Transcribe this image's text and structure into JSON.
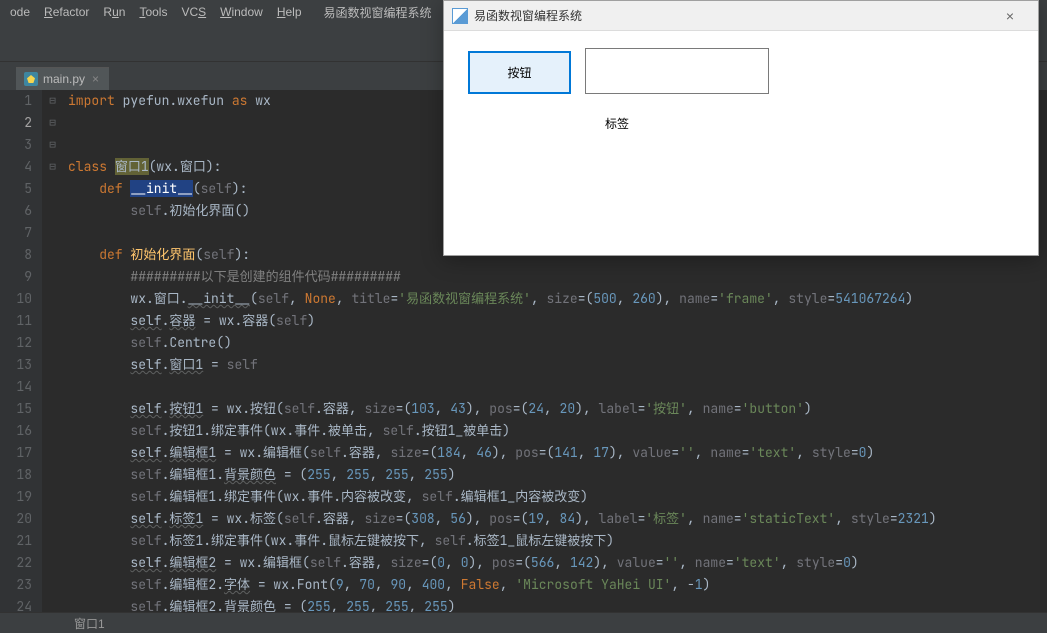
{
  "menu": {
    "items": [
      {
        "mne": "",
        "rest": "ode"
      },
      {
        "mne": "R",
        "rest": "efactor"
      },
      {
        "mne": "R",
        "rest": "u",
        "tail": "n"
      },
      {
        "mne": "T",
        "rest": "ools"
      },
      {
        "mne": "",
        "rest": "VC",
        "tail": "S"
      },
      {
        "mne": "W",
        "rest": "indow"
      },
      {
        "mne": "H",
        "rest": "elp"
      }
    ],
    "cn_menu": "易函数视窗编程系统"
  },
  "tab": {
    "name": "main.py",
    "close": "×"
  },
  "statusbar": {
    "text": "窗口1"
  },
  "gutter_current": 2,
  "popup": {
    "title": "易函数视窗编程系统",
    "button_label": "按钮",
    "input_value": "",
    "label_text": "标签",
    "close": "×"
  },
  "code": [
    {
      "n": 1,
      "tokens": [
        [
          "kw",
          "import "
        ],
        [
          "id",
          "pyefun.wxefun "
        ],
        [
          "kw",
          "as "
        ],
        [
          "id",
          "wx"
        ]
      ]
    },
    {
      "n": 2,
      "tokens": []
    },
    {
      "n": 3,
      "tokens": []
    },
    {
      "n": 4,
      "fold": "⊟",
      "tokens": [
        [
          "kw",
          "class "
        ],
        [
          "hl",
          "窗口1"
        ],
        [
          "id",
          "(wx.窗口):"
        ]
      ]
    },
    {
      "n": 5,
      "fold": "⊟",
      "tokens": [
        [
          "id",
          "    "
        ],
        [
          "kw",
          "def "
        ],
        [
          "sel",
          "__init__"
        ],
        [
          "id",
          "("
        ],
        [
          "param",
          "self"
        ],
        [
          "id",
          "):"
        ]
      ]
    },
    {
      "n": 6,
      "fold": "⊟",
      "tokens": [
        [
          "id",
          "        "
        ],
        [
          "param",
          "self"
        ],
        [
          "id",
          ".初始化界面()"
        ]
      ]
    },
    {
      "n": 7,
      "tokens": []
    },
    {
      "n": 8,
      "fold": "⊟",
      "tokens": [
        [
          "id",
          "    "
        ],
        [
          "kw",
          "def "
        ],
        [
          "fn",
          "初始化界面"
        ],
        [
          "id",
          "("
        ],
        [
          "param",
          "self"
        ],
        [
          "id",
          "):"
        ]
      ]
    },
    {
      "n": 9,
      "tokens": [
        [
          "id",
          "        "
        ],
        [
          "cmt",
          "#########以下是创建的组件代码#########"
        ]
      ]
    },
    {
      "n": 10,
      "tokens": [
        [
          "id",
          "        wx.窗口."
        ],
        [
          "ul",
          "__init__"
        ],
        [
          "id",
          "("
        ],
        [
          "param",
          "self"
        ],
        [
          "id",
          ", "
        ],
        [
          "kw",
          "None"
        ],
        [
          "id",
          ", "
        ],
        [
          "param",
          "title"
        ],
        [
          "id",
          "="
        ],
        [
          "str",
          "'易函数视窗编程系统'"
        ],
        [
          "id",
          ", "
        ],
        [
          "param",
          "size"
        ],
        [
          "id",
          "=("
        ],
        [
          "num",
          "500"
        ],
        [
          "id",
          ", "
        ],
        [
          "num",
          "260"
        ],
        [
          "id",
          "), "
        ],
        [
          "param",
          "name"
        ],
        [
          "id",
          "="
        ],
        [
          "str",
          "'frame'"
        ],
        [
          "id",
          ", "
        ],
        [
          "param",
          "style"
        ],
        [
          "id",
          "="
        ],
        [
          "num",
          "541067264"
        ],
        [
          "id",
          ")"
        ]
      ]
    },
    {
      "n": 11,
      "tokens": [
        [
          "id",
          "        "
        ],
        [
          "ul",
          "self"
        ],
        [
          "id",
          "."
        ],
        [
          "ul",
          "容器"
        ],
        [
          "id",
          " = wx.容器("
        ],
        [
          "param",
          "self"
        ],
        [
          "id",
          ")"
        ]
      ]
    },
    {
      "n": 12,
      "tokens": [
        [
          "id",
          "        "
        ],
        [
          "param",
          "self"
        ],
        [
          "id",
          ".Centre()"
        ]
      ]
    },
    {
      "n": 13,
      "tokens": [
        [
          "id",
          "        "
        ],
        [
          "ul",
          "self"
        ],
        [
          "id",
          "."
        ],
        [
          "ul",
          "窗口1"
        ],
        [
          "id",
          " = "
        ],
        [
          "param",
          "self"
        ]
      ]
    },
    {
      "n": 14,
      "tokens": []
    },
    {
      "n": 15,
      "tokens": [
        [
          "id",
          "        "
        ],
        [
          "ul",
          "self"
        ],
        [
          "id",
          "."
        ],
        [
          "ul",
          "按钮1"
        ],
        [
          "id",
          " = wx.按钮("
        ],
        [
          "param",
          "self"
        ],
        [
          "id",
          ".容器, "
        ],
        [
          "param",
          "size"
        ],
        [
          "id",
          "=("
        ],
        [
          "num",
          "103"
        ],
        [
          "id",
          ", "
        ],
        [
          "num",
          "43"
        ],
        [
          "id",
          "), "
        ],
        [
          "param",
          "pos"
        ],
        [
          "id",
          "=("
        ],
        [
          "num",
          "24"
        ],
        [
          "id",
          ", "
        ],
        [
          "num",
          "20"
        ],
        [
          "id",
          "), "
        ],
        [
          "param",
          "label"
        ],
        [
          "id",
          "="
        ],
        [
          "str",
          "'按钮'"
        ],
        [
          "id",
          ", "
        ],
        [
          "param",
          "name"
        ],
        [
          "id",
          "="
        ],
        [
          "str",
          "'button'"
        ],
        [
          "id",
          ")"
        ]
      ]
    },
    {
      "n": 16,
      "tokens": [
        [
          "id",
          "        "
        ],
        [
          "param",
          "self"
        ],
        [
          "id",
          ".按钮1.绑定事件(wx.事件.被单击, "
        ],
        [
          "param",
          "self"
        ],
        [
          "id",
          ".按钮1_被单击)"
        ]
      ]
    },
    {
      "n": 17,
      "tokens": [
        [
          "id",
          "        "
        ],
        [
          "ul",
          "self"
        ],
        [
          "id",
          "."
        ],
        [
          "ul",
          "编辑框1"
        ],
        [
          "id",
          " = wx.编辑框("
        ],
        [
          "param",
          "self"
        ],
        [
          "id",
          ".容器, "
        ],
        [
          "param",
          "size"
        ],
        [
          "id",
          "=("
        ],
        [
          "num",
          "184"
        ],
        [
          "id",
          ", "
        ],
        [
          "num",
          "46"
        ],
        [
          "id",
          "), "
        ],
        [
          "param",
          "pos"
        ],
        [
          "id",
          "=("
        ],
        [
          "num",
          "141"
        ],
        [
          "id",
          ", "
        ],
        [
          "num",
          "17"
        ],
        [
          "id",
          "), "
        ],
        [
          "param",
          "value"
        ],
        [
          "id",
          "="
        ],
        [
          "str",
          "''"
        ],
        [
          "id",
          ", "
        ],
        [
          "param",
          "name"
        ],
        [
          "id",
          "="
        ],
        [
          "str",
          "'text'"
        ],
        [
          "id",
          ", "
        ],
        [
          "param",
          "style"
        ],
        [
          "id",
          "="
        ],
        [
          "num",
          "0"
        ],
        [
          "id",
          ")"
        ]
      ]
    },
    {
      "n": 18,
      "tokens": [
        [
          "id",
          "        "
        ],
        [
          "param",
          "self"
        ],
        [
          "id",
          ".编辑框1."
        ],
        [
          "ul",
          "背景颜色"
        ],
        [
          "id",
          " = ("
        ],
        [
          "num",
          "255"
        ],
        [
          "id",
          ", "
        ],
        [
          "num",
          "255"
        ],
        [
          "id",
          ", "
        ],
        [
          "num",
          "255"
        ],
        [
          "id",
          ", "
        ],
        [
          "num",
          "255"
        ],
        [
          "id",
          ")"
        ]
      ]
    },
    {
      "n": 19,
      "tokens": [
        [
          "id",
          "        "
        ],
        [
          "param",
          "self"
        ],
        [
          "id",
          ".编辑框1.绑定事件(wx.事件.内容被改变, "
        ],
        [
          "param",
          "self"
        ],
        [
          "id",
          ".编辑框1_内容被改变)"
        ]
      ]
    },
    {
      "n": 20,
      "tokens": [
        [
          "id",
          "        "
        ],
        [
          "ul",
          "self"
        ],
        [
          "id",
          "."
        ],
        [
          "ul",
          "标签1"
        ],
        [
          "id",
          " = wx.标签("
        ],
        [
          "param",
          "self"
        ],
        [
          "id",
          ".容器, "
        ],
        [
          "param",
          "size"
        ],
        [
          "id",
          "=("
        ],
        [
          "num",
          "308"
        ],
        [
          "id",
          ", "
        ],
        [
          "num",
          "56"
        ],
        [
          "id",
          "), "
        ],
        [
          "param",
          "pos"
        ],
        [
          "id",
          "=("
        ],
        [
          "num",
          "19"
        ],
        [
          "id",
          ", "
        ],
        [
          "num",
          "84"
        ],
        [
          "id",
          "), "
        ],
        [
          "param",
          "label"
        ],
        [
          "id",
          "="
        ],
        [
          "str",
          "'标签'"
        ],
        [
          "id",
          ", "
        ],
        [
          "param",
          "name"
        ],
        [
          "id",
          "="
        ],
        [
          "str",
          "'staticText'"
        ],
        [
          "id",
          ", "
        ],
        [
          "param",
          "style"
        ],
        [
          "id",
          "="
        ],
        [
          "num",
          "2321"
        ],
        [
          "id",
          ")"
        ]
      ]
    },
    {
      "n": 21,
      "tokens": [
        [
          "id",
          "        "
        ],
        [
          "param",
          "self"
        ],
        [
          "id",
          ".标签1.绑定事件(wx.事件.鼠标左键被按下, "
        ],
        [
          "param",
          "self"
        ],
        [
          "id",
          ".标签1_鼠标左键被按下)"
        ]
      ]
    },
    {
      "n": 22,
      "tokens": [
        [
          "id",
          "        "
        ],
        [
          "ul",
          "self"
        ],
        [
          "id",
          "."
        ],
        [
          "ul",
          "编辑框2"
        ],
        [
          "id",
          " = wx.编辑框("
        ],
        [
          "param",
          "self"
        ],
        [
          "id",
          ".容器, "
        ],
        [
          "param",
          "size"
        ],
        [
          "id",
          "=("
        ],
        [
          "num",
          "0"
        ],
        [
          "id",
          ", "
        ],
        [
          "num",
          "0"
        ],
        [
          "id",
          "), "
        ],
        [
          "param",
          "pos"
        ],
        [
          "id",
          "=("
        ],
        [
          "num",
          "566"
        ],
        [
          "id",
          ", "
        ],
        [
          "num",
          "142"
        ],
        [
          "id",
          "), "
        ],
        [
          "param",
          "value"
        ],
        [
          "id",
          "="
        ],
        [
          "str",
          "''"
        ],
        [
          "id",
          ", "
        ],
        [
          "param",
          "name"
        ],
        [
          "id",
          "="
        ],
        [
          "str",
          "'text'"
        ],
        [
          "id",
          ", "
        ],
        [
          "param",
          "style"
        ],
        [
          "id",
          "="
        ],
        [
          "num",
          "0"
        ],
        [
          "id",
          ")"
        ]
      ]
    },
    {
      "n": 23,
      "tokens": [
        [
          "id",
          "        "
        ],
        [
          "param",
          "self"
        ],
        [
          "id",
          ".编辑框2."
        ],
        [
          "ul",
          "字体"
        ],
        [
          "id",
          " = wx.Font("
        ],
        [
          "num",
          "9"
        ],
        [
          "id",
          ", "
        ],
        [
          "num",
          "70"
        ],
        [
          "id",
          ", "
        ],
        [
          "num",
          "90"
        ],
        [
          "id",
          ", "
        ],
        [
          "num",
          "400"
        ],
        [
          "id",
          ", "
        ],
        [
          "kw",
          "False"
        ],
        [
          "id",
          ", "
        ],
        [
          "str",
          "'Microsoft YaHei UI'"
        ],
        [
          "id",
          ", -"
        ],
        [
          "num",
          "1"
        ],
        [
          "id",
          ")"
        ]
      ]
    },
    {
      "n": 24,
      "tokens": [
        [
          "id",
          "        "
        ],
        [
          "param",
          "self"
        ],
        [
          "id",
          ".编辑框2."
        ],
        [
          "ul",
          "背景颜色"
        ],
        [
          "id",
          " = ("
        ],
        [
          "num",
          "255"
        ],
        [
          "id",
          ", "
        ],
        [
          "num",
          "255"
        ],
        [
          "id",
          ", "
        ],
        [
          "num",
          "255"
        ],
        [
          "id",
          ", "
        ],
        [
          "num",
          "255"
        ],
        [
          "id",
          ")"
        ]
      ]
    }
  ]
}
